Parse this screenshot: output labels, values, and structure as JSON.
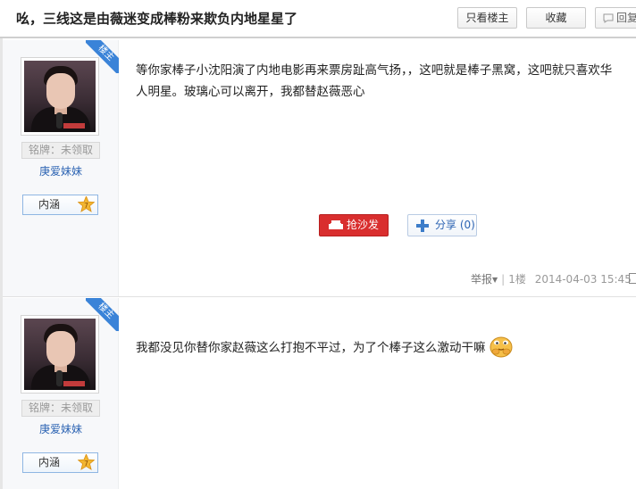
{
  "thread": {
    "title": "吆，三线这是由薇迷变成棒粉来欺负内地星星了",
    "only_op_label": "只看楼主",
    "favorite_label": "收藏",
    "reply_label": "回复"
  },
  "posts": [
    {
      "op_badge": "楼主",
      "medal": "铭牌：未领取",
      "username": "庚爱妹妹",
      "neihan_label": "内涵",
      "neihan_level": "7",
      "content_line1": "等你家棒子小沈阳演了内地电影再来票房趾高气扬，，这吧就是棒子黑窝，这吧就只喜欢华",
      "content_line2": "人明星。玻璃心可以离开，我都替赵薇恶心",
      "sofa_label": "抢沙发",
      "share_label": "分享 (0)",
      "report_label": "举报",
      "floor": "1楼",
      "timestamp": "2014-04-03 15:45"
    },
    {
      "op_badge": "楼主",
      "medal": "铭牌：未领取",
      "username": "庚爱妹妹",
      "neihan_label": "内涵",
      "neihan_level": "7",
      "content_line1": "我都没见你替你家赵薇这么打抱不平过，为了个棒子这么激动干嘛"
    }
  ],
  "colors": {
    "accent_blue": "#3a83d8",
    "sofa_red": "#d92e2e",
    "username_blue": "#2d64b3"
  },
  "icons": [
    "comment-icon",
    "sofa-icon",
    "plus-share-icon",
    "star-badge-icon",
    "emoji-pleading-icon"
  ]
}
